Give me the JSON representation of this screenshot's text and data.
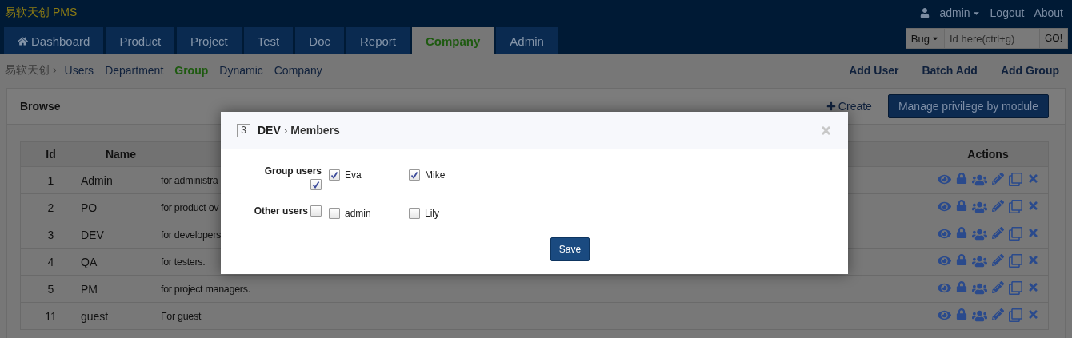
{
  "app": {
    "brand": "易软天创 PMS"
  },
  "user_menu": {
    "user": "admin",
    "links": [
      "Logout",
      "About"
    ]
  },
  "tabs": [
    {
      "label": "Dashboard",
      "selected": false
    },
    {
      "label": "Product",
      "selected": false
    },
    {
      "label": "Project",
      "selected": false
    },
    {
      "label": "Test",
      "selected": false
    },
    {
      "label": "Doc",
      "selected": false
    },
    {
      "label": "Report",
      "selected": false
    },
    {
      "label": "Company",
      "selected": true
    },
    {
      "label": "Admin",
      "selected": false
    }
  ],
  "quick_jump": {
    "type": "Bug",
    "placeholder": "Id here(ctrl+g)",
    "button": "GO!"
  },
  "subnav": {
    "root": "易软天创",
    "separator": "›",
    "items": [
      {
        "label": "Users",
        "selected": false
      },
      {
        "label": "Department",
        "selected": false
      },
      {
        "label": "Group",
        "selected": true
      },
      {
        "label": "Dynamic",
        "selected": false
      },
      {
        "label": "Company",
        "selected": false
      }
    ],
    "actions": [
      "Add User",
      "Batch Add",
      "Add Group"
    ]
  },
  "panel": {
    "title": "Browse",
    "create": "Create",
    "manage": "Manage privilege by module"
  },
  "table": {
    "columns": {
      "id": "Id",
      "name": "Name",
      "actions": "Actions"
    },
    "rows": [
      {
        "id": "1",
        "name": "Admin",
        "description": "for administra"
      },
      {
        "id": "2",
        "name": "PO",
        "description": "for product ov"
      },
      {
        "id": "3",
        "name": "DEV",
        "description": "for developers"
      },
      {
        "id": "4",
        "name": "QA",
        "description": "for testers."
      },
      {
        "id": "5",
        "name": "PM",
        "description": "for project managers."
      },
      {
        "id": "11",
        "name": "guest",
        "description": "For guest"
      }
    ]
  },
  "modal": {
    "number": "3",
    "group": "DEV",
    "separator": "›",
    "section": "Members",
    "groups": [
      {
        "label": "Group users",
        "all_checked": true,
        "users": [
          {
            "name": "Eva",
            "checked": true
          },
          {
            "name": "Mike",
            "checked": true
          }
        ]
      },
      {
        "label": "Other users",
        "all_checked": false,
        "users": [
          {
            "name": "admin",
            "checked": false
          },
          {
            "name": "Lily",
            "checked": false
          }
        ]
      }
    ],
    "save": "Save"
  }
}
